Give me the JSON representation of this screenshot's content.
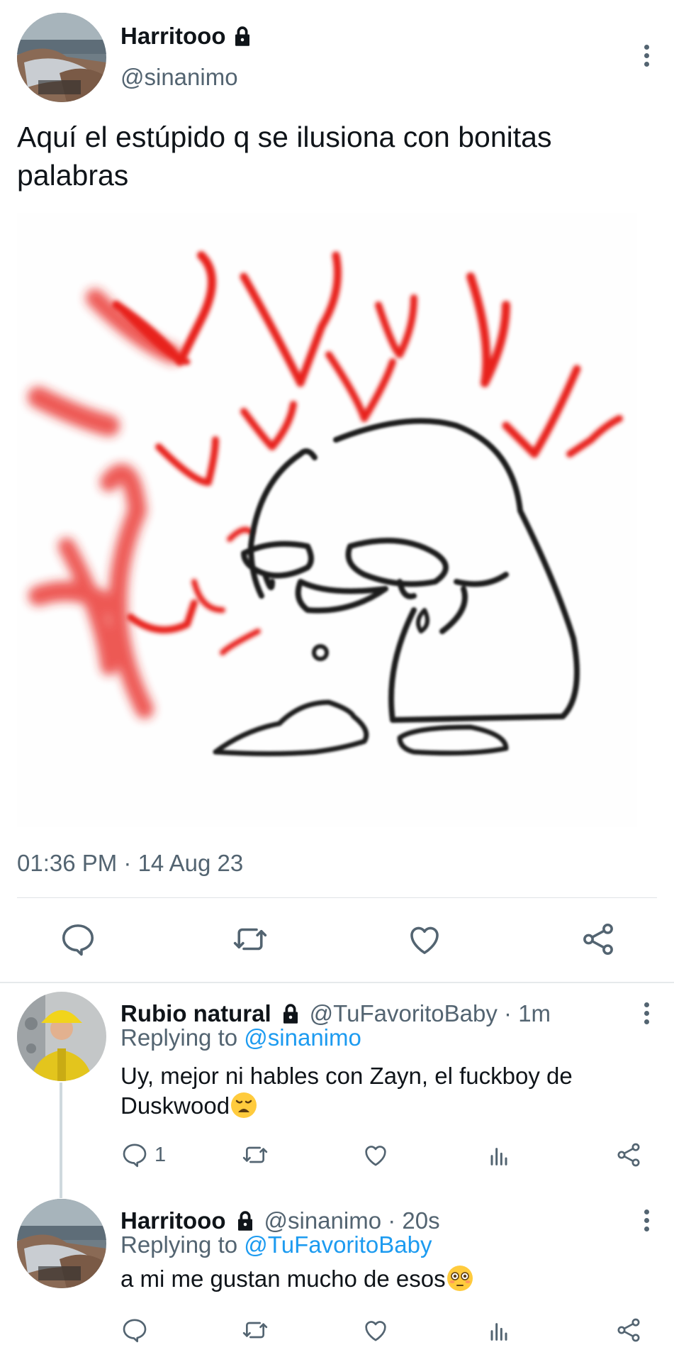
{
  "main_tweet": {
    "author_name": "Harritooo",
    "handle": "@sinanimo",
    "text": "Aquí el estúpido q se ilusiona con bonitas palabras",
    "timestamp": "01:36 PM · 14 Aug 23",
    "actions": [
      "reply-icon",
      "retweet-icon",
      "like-icon",
      "share-icon"
    ]
  },
  "replies": [
    {
      "author_name": "Rubio natural",
      "meta": "@TuFavoritoBaby · 1m",
      "replying_prefix": "Replying to",
      "replying_to": "@sinanimo",
      "text": "Uy, mejor ni hables con Zayn, el fuckboy de Duskwood",
      "emoji": "weary-face",
      "reply_count": "1"
    },
    {
      "author_name": "Harritooo",
      "meta": "@sinanimo · 20s",
      "replying_prefix": "Replying to",
      "replying_to": "@TuFavoritoBaby",
      "text": "a mi me gustan mucho de esos",
      "emoji": "flushed-face"
    }
  ],
  "colors": {
    "text": "#0f1419",
    "secondary": "#536471",
    "mention": "#1d9bf0",
    "divider": "#dfe3e6",
    "heart_red": "#e8231f"
  }
}
